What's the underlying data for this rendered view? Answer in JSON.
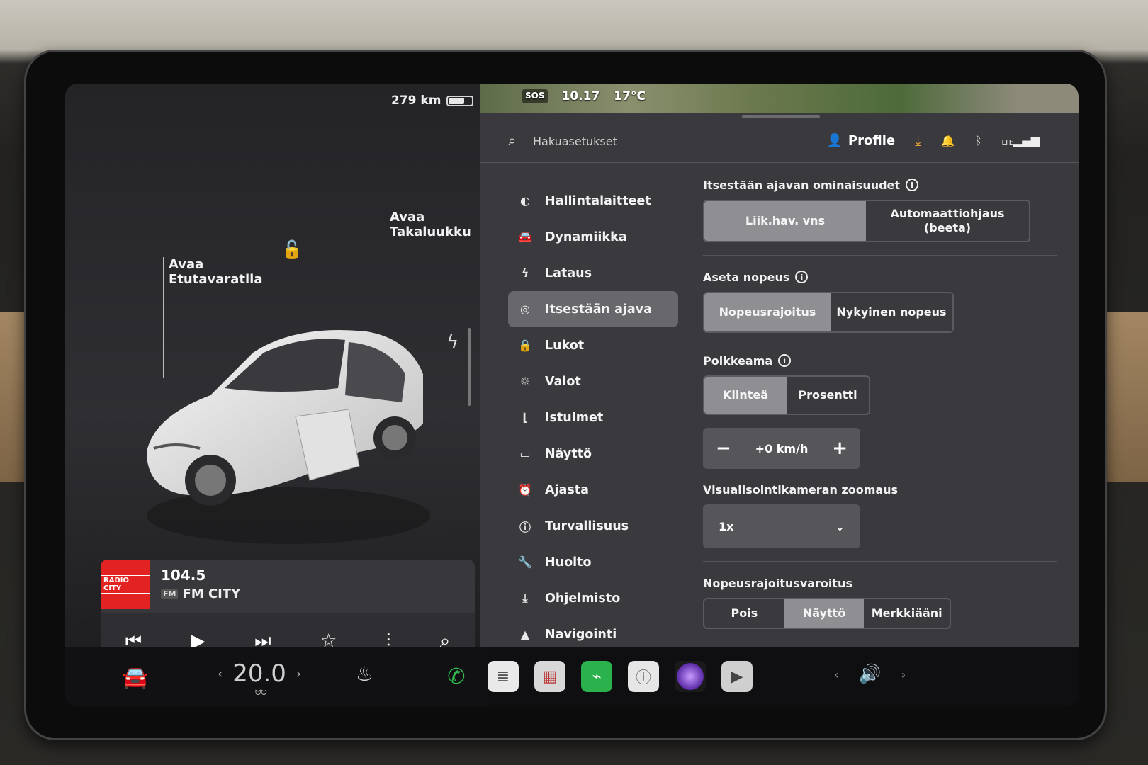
{
  "car": {
    "range": "279 km",
    "battery_fill_pct": 62,
    "frunk_label_1": "Avaa",
    "frunk_label_2": "Etutavaratila",
    "trunk_label_1": "Avaa",
    "trunk_label_2": "Takaluukku"
  },
  "media": {
    "frequency": "104.5",
    "station": "FM CITY",
    "art_text": "RADIO CITY",
    "signal_badge": "FM"
  },
  "status": {
    "sos": "SOS",
    "time": "10.17",
    "temperature": "17°C"
  },
  "search": {
    "placeholder": "Hakuasetukset"
  },
  "topbar": {
    "profile_label": "Profile",
    "lte": "LTE"
  },
  "menu": {
    "items": [
      {
        "label": "Hallintalaitteet",
        "icon": "toggle-icon"
      },
      {
        "label": "Dynamiikka",
        "icon": "car-icon"
      },
      {
        "label": "Lataus",
        "icon": "bolt-icon"
      },
      {
        "label": "Itsestään ajava",
        "icon": "steering-wheel-icon"
      },
      {
        "label": "Lukot",
        "icon": "lock-icon"
      },
      {
        "label": "Valot",
        "icon": "sun-icon"
      },
      {
        "label": "Istuimet",
        "icon": "seat-icon"
      },
      {
        "label": "Näyttö",
        "icon": "display-icon"
      },
      {
        "label": "Ajasta",
        "icon": "alarm-icon"
      },
      {
        "label": "Turvallisuus",
        "icon": "alert-icon"
      },
      {
        "label": "Huolto",
        "icon": "wrench-icon"
      },
      {
        "label": "Ohjelmisto",
        "icon": "download-icon"
      },
      {
        "label": "Navigointi",
        "icon": "navigation-icon"
      }
    ]
  },
  "pane": {
    "autopilot_title": "Itsestään ajavan ominaisuudet",
    "autopilot_opt1": "Liik.hav. vns",
    "autopilot_opt2": "Automaattiohjaus (beeta)",
    "speed_title": "Aseta nopeus",
    "speed_opt1": "Nopeusrajoitus",
    "speed_opt2": "Nykyinen nopeus",
    "offset_title": "Poikkeama",
    "offset_opt1": "Kiinteä",
    "offset_opt2": "Prosentti",
    "offset_value": "+0 km/h",
    "zoom_title": "Visualisointikameran zoomaus",
    "zoom_value": "1x",
    "warning_title": "Nopeusrajoitusvaroitus",
    "warning_opt1": "Pois",
    "warning_opt2": "Näyttö",
    "warning_opt3": "Merkkiääni"
  },
  "taskbar": {
    "temperature": "20.0",
    "defrost": "ᗢᗢ"
  },
  "colors": {
    "accent_download": "#e8a43a",
    "phone_green": "#2fbe4f",
    "radio_red": "#e32222"
  }
}
